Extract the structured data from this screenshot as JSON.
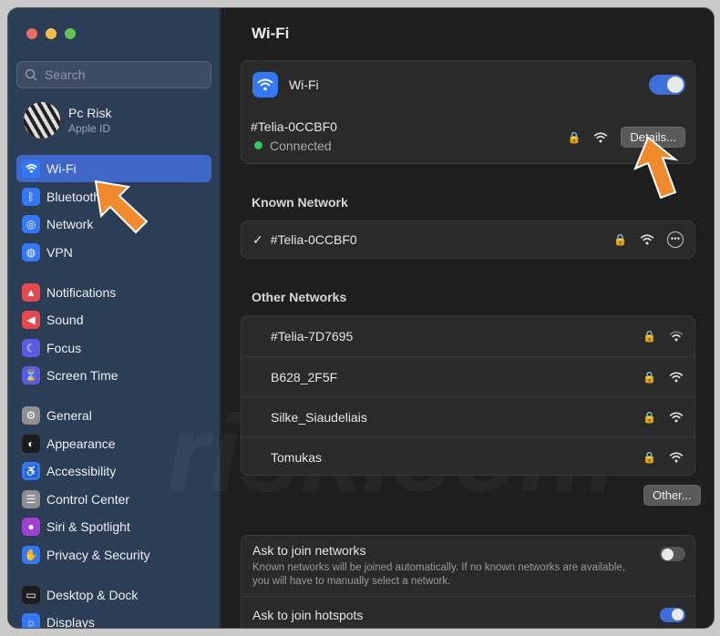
{
  "window": {
    "traffic_colors": [
      "#ec6a5e",
      "#f4bf4f",
      "#61c554"
    ]
  },
  "sidebar": {
    "search_placeholder": "Search",
    "account": {
      "name": "Pc Risk",
      "subtitle": "Apple ID"
    },
    "groups": [
      [
        {
          "label": "Wi-Fi",
          "icon": "wifi-icon",
          "color": "#3478f6",
          "active": true
        },
        {
          "label": "Bluetooth",
          "icon": "bluetooth-icon",
          "color": "#3478f6"
        },
        {
          "label": "Network",
          "icon": "globe-icon",
          "color": "#3478f6"
        },
        {
          "label": "VPN",
          "icon": "vpn-icon",
          "color": "#3478f6"
        }
      ],
      [
        {
          "label": "Notifications",
          "icon": "bell-icon",
          "color": "#e5484d"
        },
        {
          "label": "Sound",
          "icon": "speaker-icon",
          "color": "#e5484d"
        },
        {
          "label": "Focus",
          "icon": "moon-icon",
          "color": "#5b5ce2"
        },
        {
          "label": "Screen Time",
          "icon": "hourglass-icon",
          "color": "#5b5ce2"
        }
      ],
      [
        {
          "label": "General",
          "icon": "gear-icon",
          "color": "#8e8e93"
        },
        {
          "label": "Appearance",
          "icon": "appearance-icon",
          "color": "#1c1c1e"
        },
        {
          "label": "Accessibility",
          "icon": "accessibility-icon",
          "color": "#3478f6"
        },
        {
          "label": "Control Center",
          "icon": "control-center-icon",
          "color": "#8e8e93"
        },
        {
          "label": "Siri & Spotlight",
          "icon": "siri-icon",
          "color": "#a040d0"
        },
        {
          "label": "Privacy & Security",
          "icon": "hand-icon",
          "color": "#3478f6"
        }
      ],
      [
        {
          "label": "Desktop & Dock",
          "icon": "dock-icon",
          "color": "#1c1c1e"
        },
        {
          "label": "Displays",
          "icon": "display-icon",
          "color": "#3478f6"
        }
      ]
    ]
  },
  "main": {
    "title": "Wi-Fi",
    "wifi_card": {
      "label": "Wi-Fi",
      "toggle_on": true,
      "network_name": "#Telia-0CCBF0",
      "status": "Connected",
      "status_color": "#34c759",
      "details_button": "Details..."
    },
    "known_section": "Known Network",
    "known_network": {
      "check": "✓",
      "name": "#Telia-0CCBF0"
    },
    "other_section": "Other Networks",
    "other_networks": [
      {
        "name": "#Telia-7D7695"
      },
      {
        "name": "B628_2F5F"
      },
      {
        "name": "Silke_Siaudeliais"
      },
      {
        "name": "Tomukas"
      }
    ],
    "other_button": "Other...",
    "ask_networks": {
      "title": "Ask to join networks",
      "description": "Known networks will be joined automatically. If no known networks are available, you will have to manually select a network.",
      "toggle_on": false
    },
    "ask_hotspots": {
      "title": "Ask to join hotspots",
      "toggle_on": true
    }
  }
}
